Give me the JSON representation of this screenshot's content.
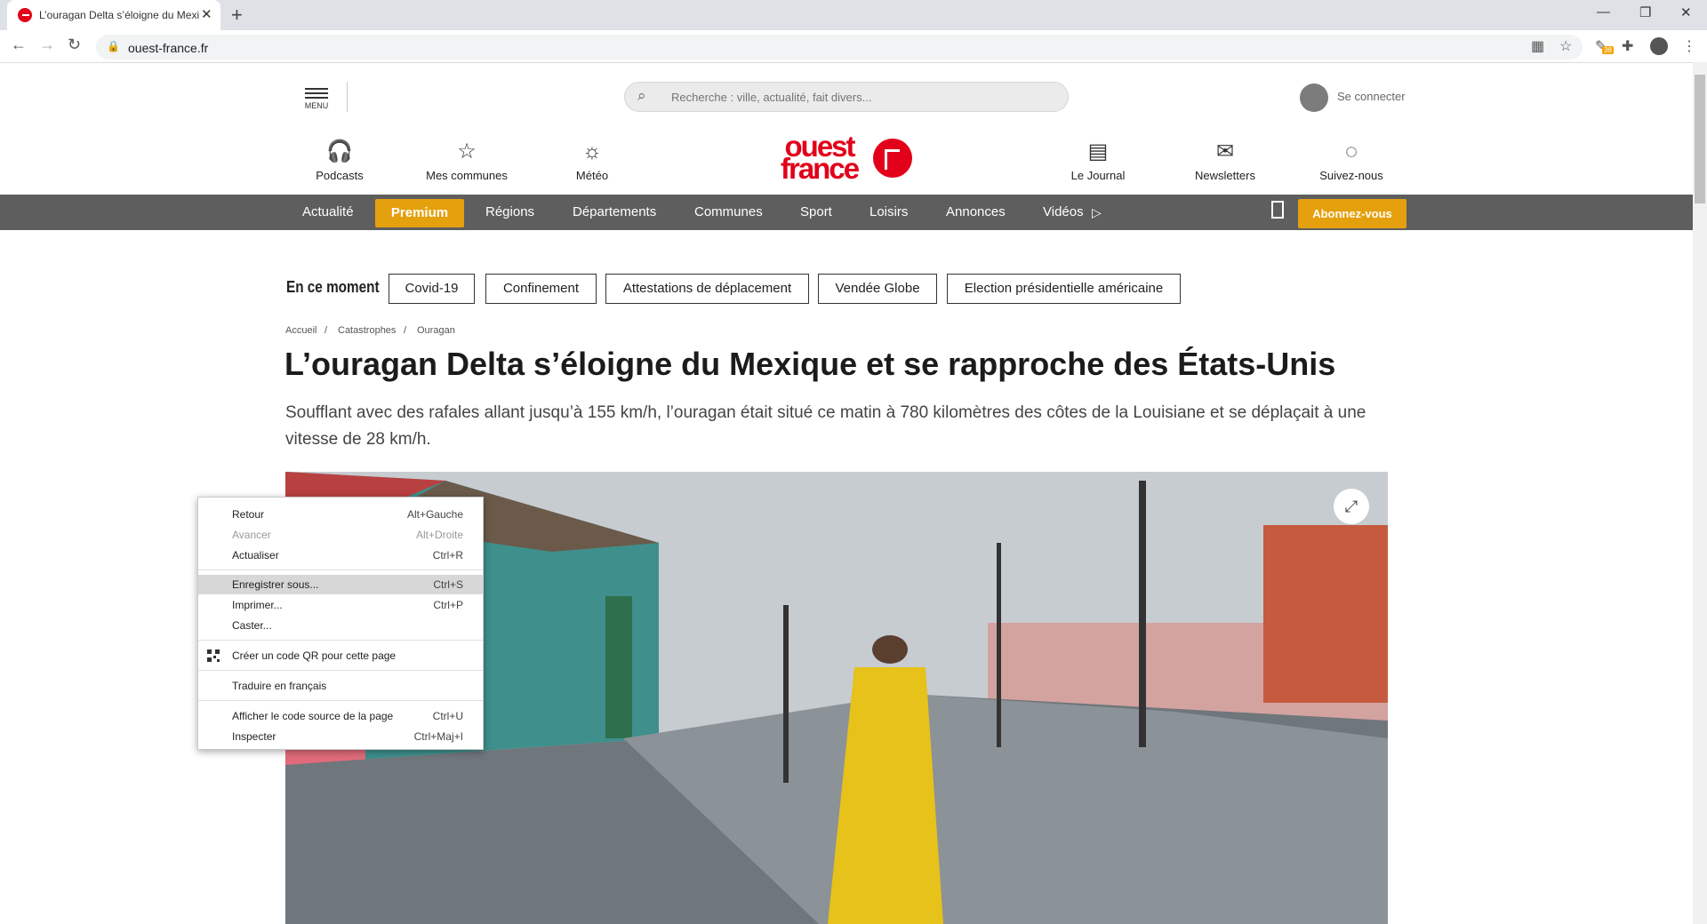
{
  "browser": {
    "tab_title": "L’ouragan Delta s’éloigne du Mexique et se rapproche des États-Unis",
    "url": "ouest-france.fr",
    "extension_badge": "38"
  },
  "header": {
    "menu_label": "MENU",
    "search_placeholder": "Recherche : ville, actualité, fait divers...",
    "login_label": "Se connecter",
    "logo_line1": "ouest",
    "logo_line2": "france",
    "items_left": [
      {
        "label": "Podcasts",
        "icon": "headphones-icon"
      },
      {
        "label": "Mes communes",
        "icon": "star-icon"
      },
      {
        "label": "Météo",
        "icon": "weather-icon"
      }
    ],
    "items_right": [
      {
        "label": "Le Journal",
        "icon": "newspaper-icon"
      },
      {
        "label": "Newsletters",
        "icon": "envelope-icon"
      },
      {
        "label": "Suivez-nous",
        "icon": "share-icon"
      }
    ]
  },
  "nav": {
    "items": [
      "Actualité",
      "Premium",
      "Régions",
      "Départements",
      "Communes",
      "Sport",
      "Loisirs",
      "Annonces",
      "Vidéos"
    ],
    "subscribe": "Abonnez-vous"
  },
  "trending": {
    "label": "En ce moment",
    "tags": [
      "Covid-19",
      "Confinement",
      "Attestations de déplacement",
      "Vendée Globe",
      "Election présidentielle américaine"
    ]
  },
  "breadcrumb": [
    "Accueil",
    "Catastrophes",
    "Ouragan"
  ],
  "article": {
    "title": "L’ouragan Delta s’éloigne du Mexique et se rapproche des États-Unis",
    "lede": "Soufflant avec des rafales allant jusqu’à 155 km/h, l’ouragan était situé ce matin à 780 kilomètres des côtes de la Louisiane et se déplaçait à une vitesse de 28 km/h."
  },
  "context_menu": {
    "items": [
      {
        "label": "Retour",
        "shortcut": "Alt+Gauche"
      },
      {
        "label": "Avancer",
        "shortcut": "Alt+Droite"
      },
      {
        "label": "Actualiser",
        "shortcut": "Ctrl+R"
      },
      {
        "label": "Enregistrer sous...",
        "shortcut": "Ctrl+S"
      },
      {
        "label": "Imprimer...",
        "shortcut": "Ctrl+P"
      },
      {
        "label": "Caster...",
        "shortcut": ""
      },
      {
        "label": "Créer un code QR pour cette page",
        "shortcut": ""
      },
      {
        "label": "Traduire en français",
        "shortcut": ""
      },
      {
        "label": "Afficher le code source de la page",
        "shortcut": "Ctrl+U"
      },
      {
        "label": "Inspecter",
        "shortcut": "Ctrl+Maj+I"
      }
    ]
  }
}
